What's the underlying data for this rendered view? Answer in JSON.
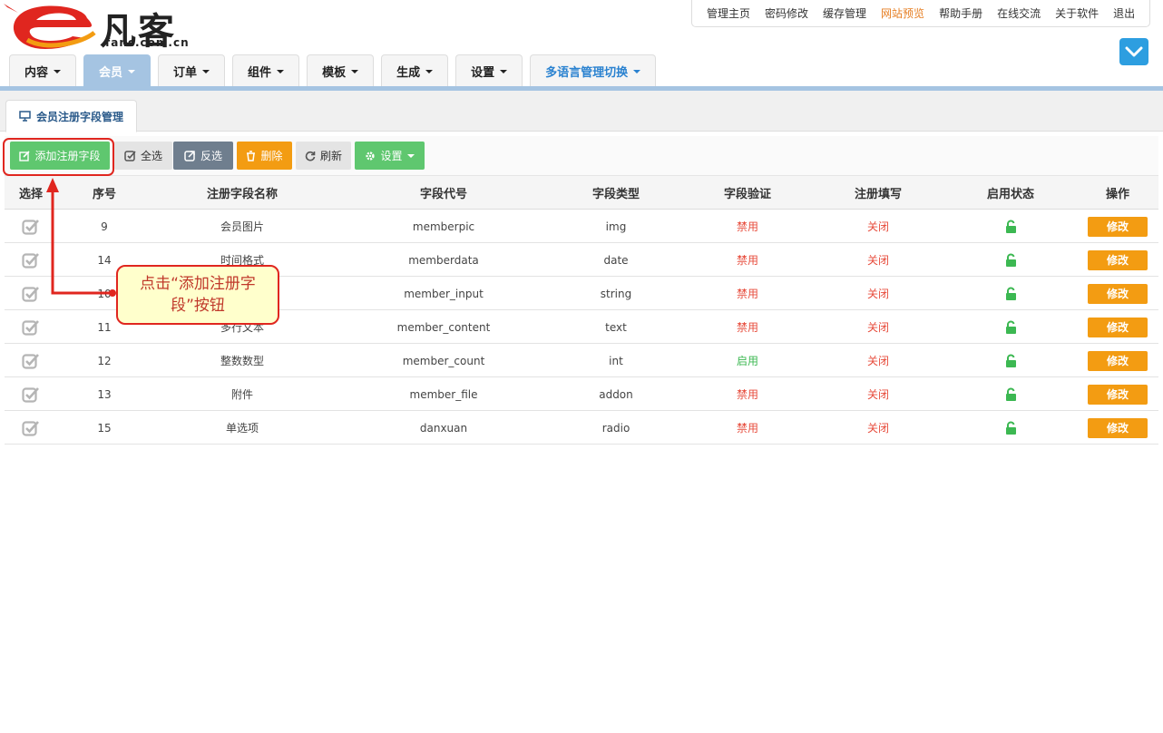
{
  "logo": {
    "text": "凡客",
    "domain": "fanc.com.cn"
  },
  "toplinks": [
    {
      "label": "管理主页"
    },
    {
      "label": "密码修改"
    },
    {
      "label": "缓存管理"
    },
    {
      "label": "网站预览"
    },
    {
      "label": "帮助手册"
    },
    {
      "label": "在线交流"
    },
    {
      "label": "关于软件"
    },
    {
      "label": "退出"
    }
  ],
  "nav": [
    {
      "label": "内容"
    },
    {
      "label": "会员"
    },
    {
      "label": "订单"
    },
    {
      "label": "组件"
    },
    {
      "label": "模板"
    },
    {
      "label": "生成"
    },
    {
      "label": "设置"
    },
    {
      "label": "多语言管理切换"
    }
  ],
  "tab": {
    "label": "会员注册字段管理"
  },
  "toolbar": {
    "add": "添加注册字段",
    "select_all": "全选",
    "invert": "反选",
    "delete": "删除",
    "refresh": "刷新",
    "settings": "设置"
  },
  "table": {
    "headers": [
      "选择",
      "序号",
      "注册字段名称",
      "字段代号",
      "字段类型",
      "字段验证",
      "注册填写",
      "启用状态",
      "操作"
    ],
    "rows": [
      {
        "id": "9",
        "name": "会员图片",
        "code": "memberpic",
        "type": "img",
        "verify": "禁用",
        "fill": "关闭",
        "action": "修改"
      },
      {
        "id": "14",
        "name": "时间格式",
        "code": "memberdata",
        "type": "date",
        "verify": "禁用",
        "fill": "关闭",
        "action": "修改"
      },
      {
        "id": "10",
        "name": "",
        "code": "member_input",
        "type": "string",
        "verify": "禁用",
        "fill": "关闭",
        "action": "修改"
      },
      {
        "id": "11",
        "name": "多行文本",
        "code": "member_content",
        "type": "text",
        "verify": "禁用",
        "fill": "关闭",
        "action": "修改"
      },
      {
        "id": "12",
        "name": "整数数型",
        "code": "member_count",
        "type": "int",
        "verify": "启用",
        "fill": "关闭",
        "action": "修改"
      },
      {
        "id": "13",
        "name": "附件",
        "code": "member_file",
        "type": "addon",
        "verify": "禁用",
        "fill": "关闭",
        "action": "修改"
      },
      {
        "id": "15",
        "name": "单选项",
        "code": "danxuan",
        "type": "radio",
        "verify": "禁用",
        "fill": "关闭",
        "action": "修改"
      }
    ]
  },
  "callout": {
    "text": "点击“添加注册字段”按钮"
  },
  "colors": {
    "accent": "#a5c4e2",
    "add": "#5fc76f",
    "warn": "#f39c12",
    "danger": "#e74c3c"
  }
}
